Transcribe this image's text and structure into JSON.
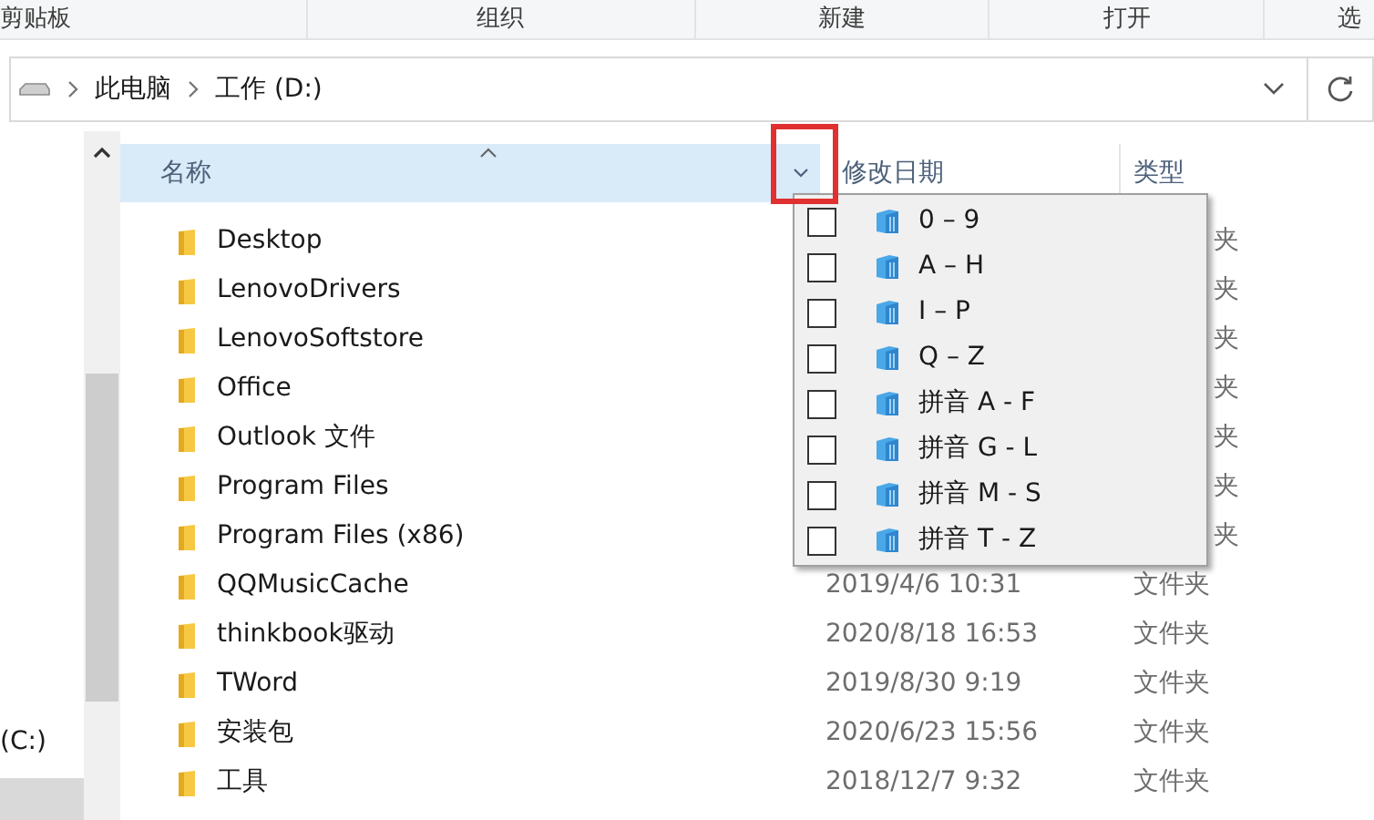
{
  "ribbon_groups": [
    "剪贴板",
    "组织",
    "新建",
    "打开",
    "选"
  ],
  "address_bar": {
    "crumbs": [
      "此电脑",
      "工作 (D:)"
    ]
  },
  "nav_pane": {
    "items": [
      {
        "label": "(C:)",
        "selected": false
      }
    ]
  },
  "columns": [
    {
      "label": "名称",
      "selected": true
    },
    {
      "label": "修改日期",
      "selected": false
    },
    {
      "label": "类型",
      "selected": false
    }
  ],
  "rows": [
    {
      "name": "Desktop",
      "type": "夹"
    },
    {
      "name": "LenovoDrivers",
      "type": "夹"
    },
    {
      "name": "LenovoSoftstore",
      "type": "夹"
    },
    {
      "name": "Office",
      "type": "夹"
    },
    {
      "name": "Outlook 文件",
      "type": "夹"
    },
    {
      "name": "Program Files",
      "type": "夹"
    },
    {
      "name": "Program Files (x86)",
      "type": "夹"
    },
    {
      "name": "QQMusicCache",
      "date": "2019/4/6 10:31",
      "type": "文件夹"
    },
    {
      "name": "thinkbook驱动",
      "date": "2020/8/18 16:53",
      "type": "文件夹"
    },
    {
      "name": "TWord",
      "date": "2019/8/30 9:19",
      "type": "文件夹"
    },
    {
      "name": "安装包",
      "date": "2020/6/23 15:56",
      "type": "文件夹"
    },
    {
      "name": "工具",
      "date": "2018/12/7 9:32",
      "type": "文件夹"
    }
  ],
  "filter_menu": {
    "items": [
      {
        "label": "0 – 9",
        "checked": false
      },
      {
        "label": "A – H",
        "checked": false
      },
      {
        "label": "I – P",
        "checked": false
      },
      {
        "label": "Q – Z",
        "checked": false
      },
      {
        "label": "拼音 A - F",
        "checked": false
      },
      {
        "label": "拼音 G - L",
        "checked": false
      },
      {
        "label": "拼音 M - S",
        "checked": false
      },
      {
        "label": "拼音 T - Z",
        "checked": false
      }
    ]
  }
}
